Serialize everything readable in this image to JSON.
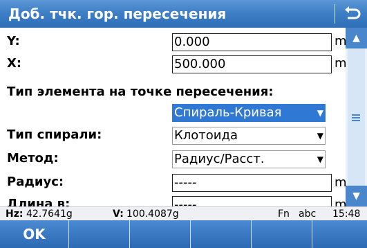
{
  "title": "Доб. тчк. гор. пересечения",
  "fields": {
    "y_label": "Y:",
    "y_value": "0.000",
    "y_unit": "m",
    "x_label": "X:",
    "x_value": "500.000",
    "x_unit": "m",
    "element_type_heading": "Тип элемента на точке пересечения:",
    "element_type_value": "Спираль-Кривая",
    "spiral_type_label": "Тип спирали:",
    "spiral_type_value": "Клотоида",
    "method_label": "Метод:",
    "method_value": "Радиус/Расст.",
    "radius_label": "Радиус:",
    "radius_value": "-----",
    "radius_unit": "m",
    "length_label": "Длина в:",
    "length_value": "-----",
    "length_unit": "m"
  },
  "status": {
    "hz_label": "Hz:",
    "hz_value": "42.7641g",
    "v_label": "V:",
    "v_value": "100.4087g",
    "fn": "Fn",
    "input_mode": "abc",
    "time": "15:48"
  },
  "fkeys": [
    "OK",
    "",
    "",
    "",
    "",
    ""
  ],
  "icons": {
    "back": "return-arrow-icon",
    "scroll_up": "triangle-up-icon",
    "scroll_down": "triangle-down-icon"
  },
  "colors": {
    "title_bar": "#3f7fc6",
    "focus": "#2f78d4"
  }
}
